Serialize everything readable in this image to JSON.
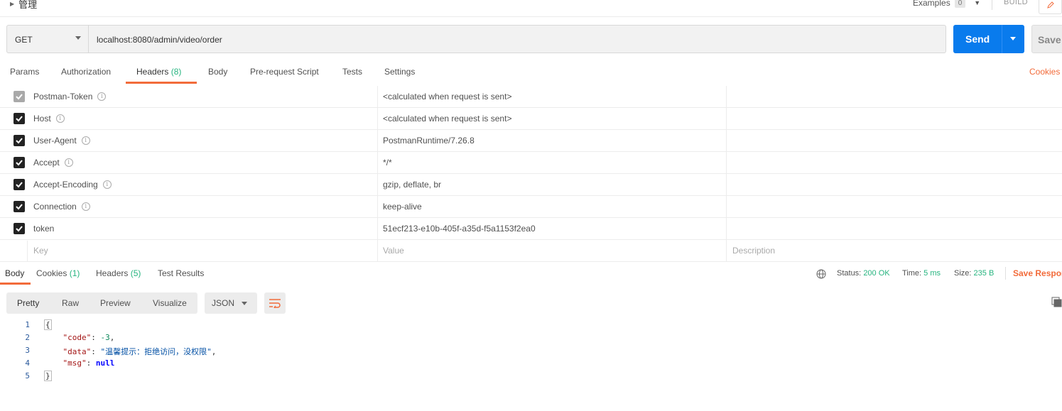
{
  "breadcrumb": {
    "title": "管理"
  },
  "top_actions": {
    "examples_label": "Examples",
    "examples_count": "0",
    "build_label": "BUILD"
  },
  "request": {
    "method": "GET",
    "url": "localhost:8080/admin/video/order",
    "send_label": "Send",
    "save_label": "Save"
  },
  "request_tabs": [
    {
      "label": "Params"
    },
    {
      "label": "Authorization"
    },
    {
      "label": "Headers",
      "count": "(8)"
    },
    {
      "label": "Body"
    },
    {
      "label": "Pre-request Script"
    },
    {
      "label": "Tests"
    },
    {
      "label": "Settings"
    }
  ],
  "cookies_link": "Cookies",
  "headers": [
    {
      "key": "Postman-Token",
      "value": "<calculated when request is sent>"
    },
    {
      "key": "Host",
      "value": "<calculated when request is sent>"
    },
    {
      "key": "User-Agent",
      "value": "PostmanRuntime/7.26.8"
    },
    {
      "key": "Accept",
      "value": "*/*"
    },
    {
      "key": "Accept-Encoding",
      "value": "gzip, deflate, br"
    },
    {
      "key": "Connection",
      "value": "keep-alive"
    },
    {
      "key": "token",
      "value": "51ecf213-e10b-405f-a35d-f5a1153f2ea0"
    }
  ],
  "headers_placeholder": {
    "key": "Key",
    "value": "Value",
    "description": "Description"
  },
  "response_tabs": [
    {
      "label": "Body"
    },
    {
      "label": "Cookies",
      "count": "(1)"
    },
    {
      "label": "Headers",
      "count": "(5)"
    },
    {
      "label": "Test Results"
    }
  ],
  "response_status": {
    "status_label": "Status:",
    "status_value": "200 OK",
    "time_label": "Time:",
    "time_value": "5 ms",
    "size_label": "Size:",
    "size_value": "235 B",
    "save_response": "Save Respor"
  },
  "view_modes": [
    "Pretty",
    "Raw",
    "Preview",
    "Visualize"
  ],
  "format": "JSON",
  "code": {
    "line_numbers": [
      "1",
      "2",
      "3",
      "4",
      "5"
    ],
    "open_brace": "{",
    "close_brace": "}",
    "code_key": "\"code\"",
    "code_val": "-3",
    "data_key": "\"data\"",
    "data_val": "\"温馨提示：拒绝访问，没权限\"",
    "msg_key": "\"msg\"",
    "msg_val": "null"
  },
  "colors": {
    "accent": "#f26b3a",
    "send": "#097bed",
    "ok": "#26b47f"
  }
}
